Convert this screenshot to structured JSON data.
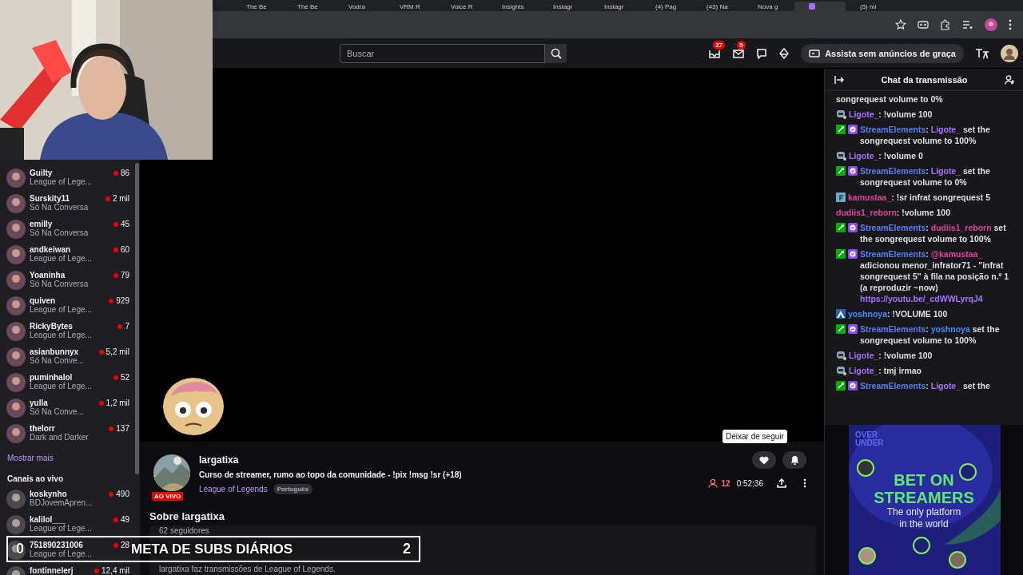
{
  "browser": {
    "tabs": [
      {
        "title": "The Be",
        "selected": false
      },
      {
        "title": "The Be",
        "selected": false
      },
      {
        "title": "Vodra",
        "selected": false
      },
      {
        "title": "VRM R",
        "selected": false
      },
      {
        "title": "Voice R",
        "selected": false
      },
      {
        "title": "Insights",
        "selected": false
      },
      {
        "title": "Instagr",
        "selected": false
      },
      {
        "title": "Instagr",
        "selected": false
      },
      {
        "title": "(4) Pag",
        "selected": false
      },
      {
        "title": "(43) Na",
        "selected": false
      },
      {
        "title": "Nova g",
        "selected": false
      },
      {
        "selected": true
      },
      {
        "title": "(5) mi",
        "selected": false
      }
    ]
  },
  "nav": {
    "search": {
      "placeholder": "Buscar"
    },
    "notifications": "27",
    "whispers": "5",
    "promo_button": "Assista sem anúncios de graça"
  },
  "sidebar": {
    "followed": [
      {
        "name": "Guilty",
        "category": "League of Lege...",
        "viewers": "86"
      },
      {
        "name": "Surskity11",
        "category": "Só Na Conversa",
        "viewers": "2 mil"
      },
      {
        "name": "emilly",
        "category": "Só Na Conversa",
        "viewers": "45"
      },
      {
        "name": "andkeiwan",
        "category": "League of Lege...",
        "viewers": "60"
      },
      {
        "name": "Yoaninha",
        "category": "Só Na Conversa",
        "viewers": "79"
      },
      {
        "name": "quiven",
        "category": "League of Lege...",
        "viewers": "929"
      },
      {
        "name": "RickyBytes",
        "category": "League of Lege...",
        "viewers": "7"
      },
      {
        "name": "asianbunnyx",
        "category": "Só Na Conve...",
        "viewers": "5,2 mil"
      },
      {
        "name": "puminhalol",
        "category": "League of Lege...",
        "viewers": "52"
      },
      {
        "name": "yulla",
        "category": "Só Na Conve...",
        "viewers": "1,2 mil"
      },
      {
        "name": "thelorr",
        "category": "Dark and Darker",
        "viewers": "137"
      }
    ],
    "show_more": "Mostrar mais",
    "live_heading": "Canais ao vivo",
    "live": [
      {
        "name": "koskynho",
        "category": "BDJovemApren...",
        "viewers": "490"
      },
      {
        "name": "kalilol___",
        "category": "League of Lege...",
        "viewers": "49"
      },
      {
        "name": "751890231006",
        "category": "League of Lege...",
        "viewers": "28"
      },
      {
        "name": "fontinnelerj",
        "viewers": "12,4 mil"
      }
    ]
  },
  "stream": {
    "tooltip": "Deixar de seguir",
    "channel": "largatixa",
    "live_badge": "AO VIVO",
    "title": "Curso de streamer, rumo ao topo da comunidade - !pix !msg !sr (+18)",
    "category": "League of Legends",
    "tag": "Português",
    "viewers": "12",
    "uptime": "0:52:36",
    "about_heading": "Sobre largatixa",
    "followers": "62 seguidores",
    "description": "largatixa faz transmissões de League of Legends."
  },
  "chat": {
    "title": "Chat da transmissão",
    "messages": [
      {
        "kind": "plain",
        "badges": false,
        "parts": [
          {
            "t": "songrequest volume to 0%"
          }
        ]
      },
      {
        "kind": "robot",
        "badges": false,
        "parts": [
          {
            "t": "Ligote_",
            "color": "#a970ff"
          },
          {
            "t": ": !volume 100"
          }
        ]
      },
      {
        "kind": "plain",
        "badges": true,
        "parts": [
          {
            "t": "StreamElements",
            "color": "#5b7cf5"
          },
          {
            "t": ": "
          },
          {
            "t": "Ligote_",
            "color": "#a970ff"
          },
          {
            "t": " set the songrequest volume to 100%"
          }
        ]
      },
      {
        "kind": "robot",
        "badges": false,
        "parts": [
          {
            "t": "Ligote_",
            "color": "#a970ff"
          },
          {
            "t": ": !volume 0"
          }
        ]
      },
      {
        "kind": "plain",
        "badges": true,
        "parts": [
          {
            "t": "StreamElements",
            "color": "#5b7cf5"
          },
          {
            "t": ": "
          },
          {
            "t": "Ligote_",
            "color": "#a970ff"
          },
          {
            "t": " set the songrequest volume to 0%"
          }
        ]
      },
      {
        "kind": "tile",
        "badges": false,
        "parts": [
          {
            "t": "kamustaa_",
            "color": "#e0429a"
          },
          {
            "t": ": !sr infrat songrequest 5"
          }
        ]
      },
      {
        "kind": "plain",
        "badges": false,
        "parts": [
          {
            "t": "dudiis1_reborn",
            "color": "#e0429a"
          },
          {
            "t": ": !volume 100"
          }
        ]
      },
      {
        "kind": "plain",
        "badges": true,
        "parts": [
          {
            "t": "StreamElements",
            "color": "#5b7cf5"
          },
          {
            "t": ": "
          },
          {
            "t": "dudiis1_reborn",
            "color": "#e0429a"
          },
          {
            "t": " set the songrequest volume to 100%"
          }
        ]
      },
      {
        "kind": "plain",
        "badges": true,
        "parts": [
          {
            "t": "StreamElements",
            "color": "#5b7cf5"
          },
          {
            "t": ": "
          },
          {
            "t": "@kamustaa_",
            "color": "#e0429a"
          },
          {
            "t": " adicionou menor_infrator71 - \"infrat songrequest 5\" à fila na posição n.º 1 (a reproduzir ~now) "
          }
        ],
        "link": "https://youtu.be/_cdWWLyrqJ4"
      },
      {
        "kind": "peak",
        "badges": false,
        "parts": [
          {
            "t": "yoshnoya",
            "color": "#3f8cff"
          },
          {
            "t": ": !VOLUME 100"
          }
        ]
      },
      {
        "kind": "plain",
        "badges": true,
        "parts": [
          {
            "t": "StreamElements",
            "color": "#5b7cf5"
          },
          {
            "t": ": "
          },
          {
            "t": "yoshnoya",
            "color": "#3f8cff"
          },
          {
            "t": " set the songrequest volume to 100%"
          }
        ]
      },
      {
        "kind": "robot",
        "badges": false,
        "parts": [
          {
            "t": "Ligote_",
            "color": "#a970ff"
          },
          {
            "t": ": !volume 100"
          }
        ]
      },
      {
        "kind": "robot",
        "badges": false,
        "parts": [
          {
            "t": "Ligote_",
            "color": "#a970ff"
          },
          {
            "t": ": tmj irmao"
          }
        ]
      },
      {
        "kind": "plain",
        "badges": true,
        "parts": [
          {
            "t": "StreamElements",
            "color": "#5b7cf5"
          },
          {
            "t": ": "
          },
          {
            "t": "Ligote_",
            "color": "#a970ff"
          },
          {
            "t": " set the"
          }
        ]
      }
    ]
  },
  "ad": {
    "logo_top": "OVER",
    "logo_bottom": "UNDER",
    "headline_1": "BET ON",
    "headline_2": "STREAMERS",
    "tagline_1": "The only platform",
    "tagline_2": "in the world"
  },
  "subs_goal": {
    "current": "0",
    "label": "META DE SUBS DIÁRIOS",
    "target": "2"
  }
}
